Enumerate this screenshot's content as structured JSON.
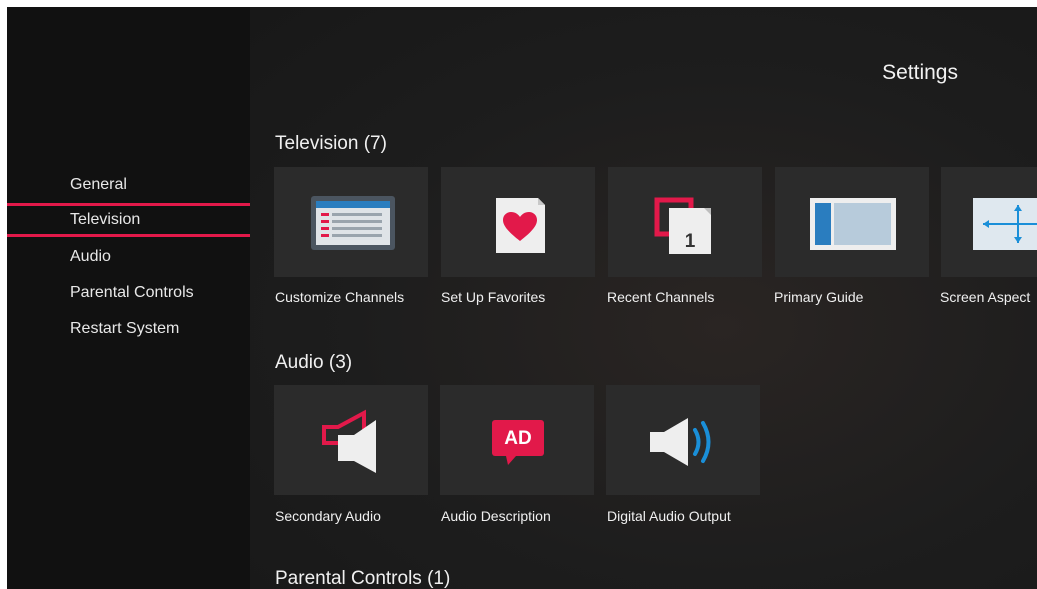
{
  "sidebar": {
    "items": [
      {
        "label": "General"
      },
      {
        "label": "Television",
        "selected": true
      },
      {
        "label": "Audio"
      },
      {
        "label": "Parental Controls"
      },
      {
        "label": "Restart System"
      }
    ]
  },
  "header": {
    "title": "Settings"
  },
  "sections": [
    {
      "label": "Television (7)",
      "tiles": [
        {
          "label": "Customize Channels",
          "icon": "channel-list-icon"
        },
        {
          "label": "Set Up Favorites",
          "icon": "heart-icon"
        },
        {
          "label": "Recent Channels",
          "icon": "recent-channels-icon"
        },
        {
          "label": "Primary Guide",
          "icon": "guide-layout-icon"
        },
        {
          "label": "Screen Aspect",
          "icon": "screen-aspect-icon"
        }
      ]
    },
    {
      "label": "Audio (3)",
      "tiles": [
        {
          "label": "Secondary Audio",
          "icon": "secondary-audio-icon"
        },
        {
          "label": "Audio Description",
          "icon": "audio-description-icon",
          "badge": "AD"
        },
        {
          "label": "Digital Audio Output",
          "icon": "speaker-wave-icon"
        }
      ]
    },
    {
      "label": "Parental Controls (1)",
      "tiles": []
    }
  ],
  "recent_channels_badge": "1",
  "colors": {
    "accent": "#e2194a",
    "blue": "#1a8fd8",
    "tile_bg": "#2b2b2b",
    "sidebar_bg": "#111111"
  }
}
